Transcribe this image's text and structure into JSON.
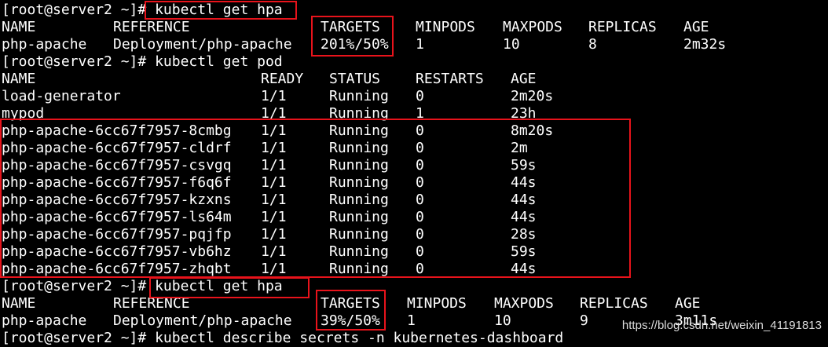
{
  "lines": [
    {
      "prompt": "[root@server2 ~]# ",
      "command": "kubectl get hpa"
    },
    {
      "cells": [
        "NAME",
        "REFERENCE",
        "TARGETS",
        "MINPODS",
        "MAXPODS",
        "REPLICAS",
        "AGE"
      ]
    },
    {
      "cells": [
        "php-apache",
        "Deployment/php-apache",
        "201%/50%",
        "1",
        "10",
        "8",
        "2m32s"
      ]
    },
    {
      "prompt": "[root@server2 ~]# ",
      "command": "kubectl get pod"
    },
    {
      "cells": [
        "NAME",
        "READY",
        "STATUS",
        "RESTARTS",
        "AGE"
      ]
    },
    {
      "cells": [
        "load-generator",
        "1/1",
        "Running",
        "0",
        "2m20s"
      ]
    },
    {
      "cells": [
        "mypod",
        "1/1",
        "Running",
        "1",
        "23h"
      ]
    },
    {
      "cells": [
        "php-apache-6cc67f7957-8cmbg",
        "1/1",
        "Running",
        "0",
        "8m20s"
      ]
    },
    {
      "cells": [
        "php-apache-6cc67f7957-cldrf",
        "1/1",
        "Running",
        "0",
        "2m"
      ]
    },
    {
      "cells": [
        "php-apache-6cc67f7957-csvgq",
        "1/1",
        "Running",
        "0",
        "59s"
      ]
    },
    {
      "cells": [
        "php-apache-6cc67f7957-f6q6f",
        "1/1",
        "Running",
        "0",
        "44s"
      ]
    },
    {
      "cells": [
        "php-apache-6cc67f7957-kzxns",
        "1/1",
        "Running",
        "0",
        "44s"
      ]
    },
    {
      "cells": [
        "php-apache-6cc67f7957-ls64m",
        "1/1",
        "Running",
        "0",
        "44s"
      ]
    },
    {
      "cells": [
        "php-apache-6cc67f7957-pqjfp",
        "1/1",
        "Running",
        "0",
        "28s"
      ]
    },
    {
      "cells": [
        "php-apache-6cc67f7957-vb6hz",
        "1/1",
        "Running",
        "0",
        "59s"
      ]
    },
    {
      "cells": [
        "php-apache-6cc67f7957-zhqbt",
        "1/1",
        "Running",
        "0",
        "44s"
      ]
    },
    {
      "prompt": "[root@server2 ~]# ",
      "command": "kubectl get hpa"
    },
    {
      "cells": [
        "NAME",
        "REFERENCE",
        "TARGETS",
        "MINPODS",
        "MAXPODS",
        "REPLICAS",
        "AGE"
      ]
    },
    {
      "cells": [
        "php-apache",
        "Deployment/php-apache",
        "39%/50%",
        "1",
        "10",
        "9",
        "3m11s"
      ]
    },
    {
      "prompt": "[root@server2 ~]# ",
      "command": "kubectl describe secrets -n kubernetes-dashboard"
    }
  ],
  "watermark": "https://blog.csdn.net/weixin_41191813",
  "colors": {
    "background": "#000000",
    "text": "#ffffff",
    "highlight": "#e8131b"
  }
}
